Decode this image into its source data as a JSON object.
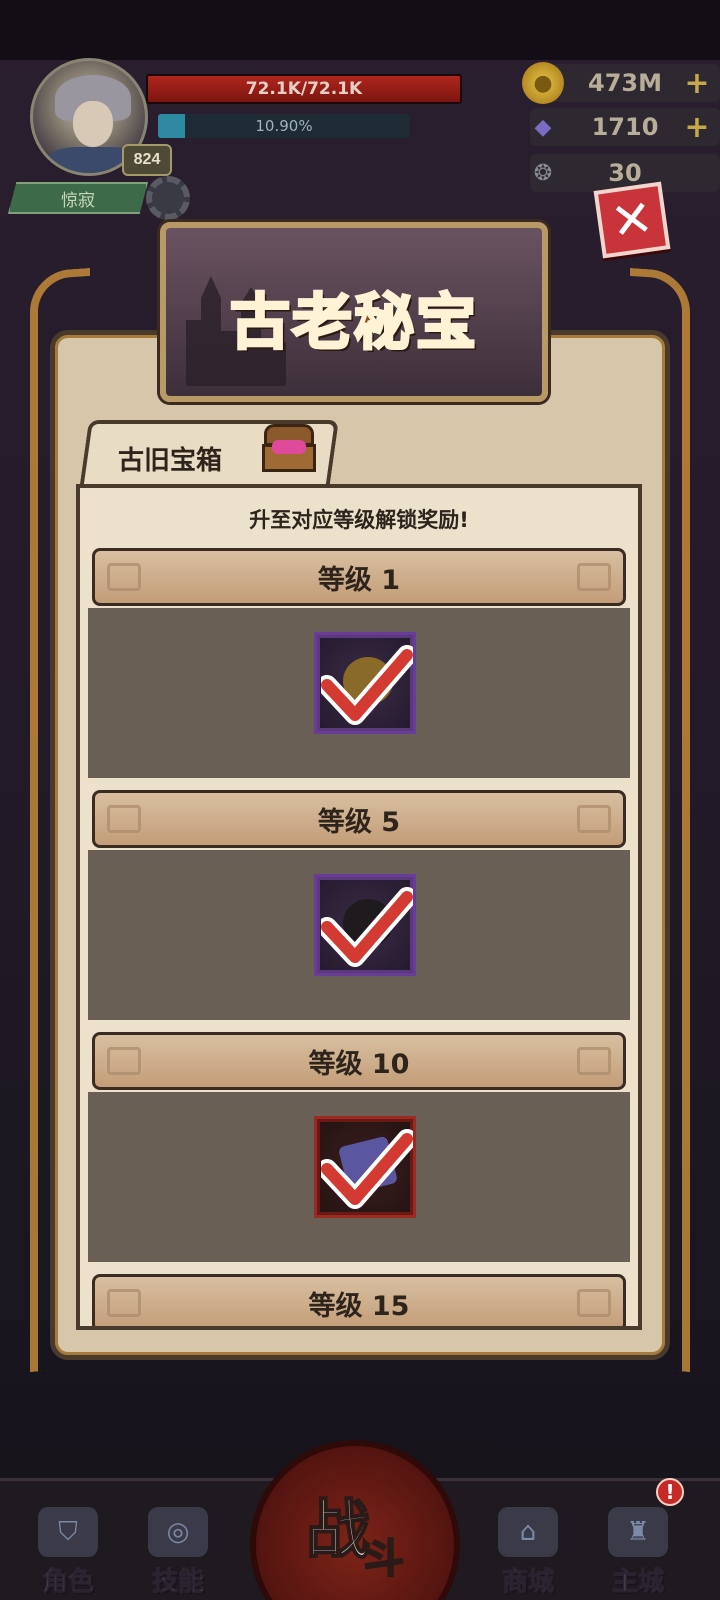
{
  "player": {
    "level": "824",
    "name": "惊寂",
    "hp_text": "72.1K/72.1K",
    "hp_fraction": 1.0,
    "exp_text": "10.90%",
    "exp_fraction": 0.109
  },
  "resources": {
    "gold": "473M",
    "gems": "1710",
    "keys": "30"
  },
  "dialog": {
    "title": "古老秘宝",
    "tab_label": "古旧宝箱",
    "hint": "升至对应等级解锁奖励!",
    "levels": [
      {
        "label": "等级 1",
        "item_frame": "purple",
        "claimed": true
      },
      {
        "label": "等级 5",
        "item_frame": "purple",
        "claimed": true
      },
      {
        "label": "等级 10",
        "item_frame": "red",
        "claimed": true
      },
      {
        "label": "等级 15"
      }
    ]
  },
  "nav": {
    "role": "角色",
    "skills": "技能",
    "fight_1": "战",
    "fight_2": "斗",
    "shop": "商城",
    "city": "主城",
    "city_alert": "!"
  },
  "colors": {
    "hp": "#b0261e",
    "exp": "#2e8aa0",
    "accent_gold": "#c48a3a",
    "check_red": "#d23a32"
  }
}
